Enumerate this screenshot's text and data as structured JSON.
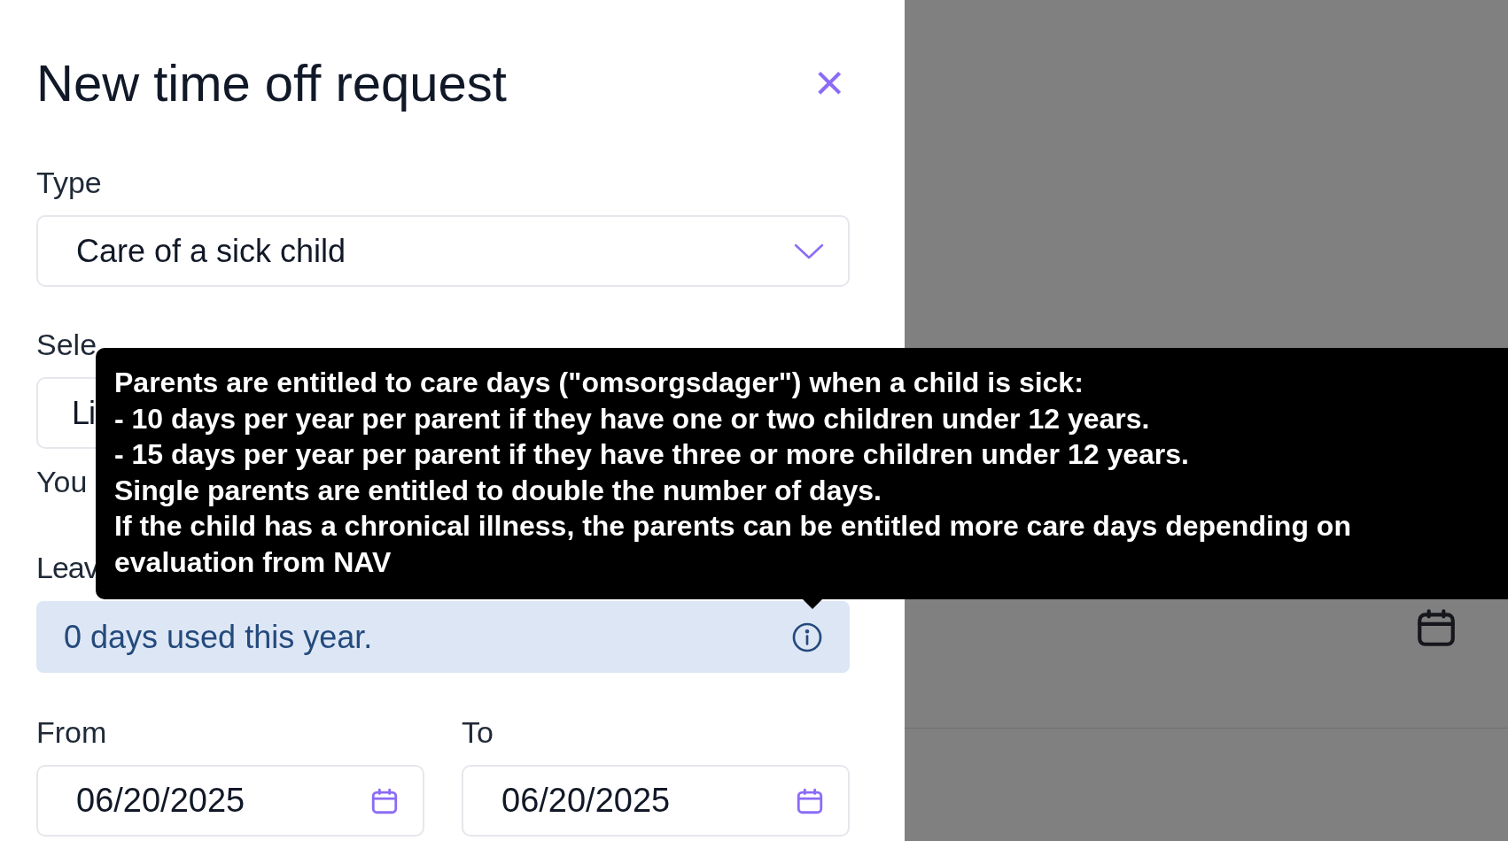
{
  "dialog": {
    "title": "New time off request",
    "close": "×",
    "type_field": {
      "label": "Type",
      "value": "Care of a sick child"
    },
    "child_field": {
      "label": "Sele",
      "value": "Li"
    },
    "notice": "You",
    "leave_label": "Leav",
    "info": {
      "text": "0 days used this year."
    },
    "from_field": {
      "label": "From",
      "value": "06/20/2025"
    },
    "to_field": {
      "label": "To",
      "value": "06/20/2025"
    }
  },
  "tooltip": {
    "lines": [
      "Parents are entitled to care days (\"omsorgsdager\") when a child is sick:",
      "- 10 days per year per parent if they have one or two children under 12 years.",
      "- 15 days per year per parent if they have three or more children under 12 years.",
      "Single parents are entitled to double the number of days.",
      "If the child has a chronical illness, the parents can be entitled more care days depending on",
      "evaluation from NAV"
    ]
  }
}
